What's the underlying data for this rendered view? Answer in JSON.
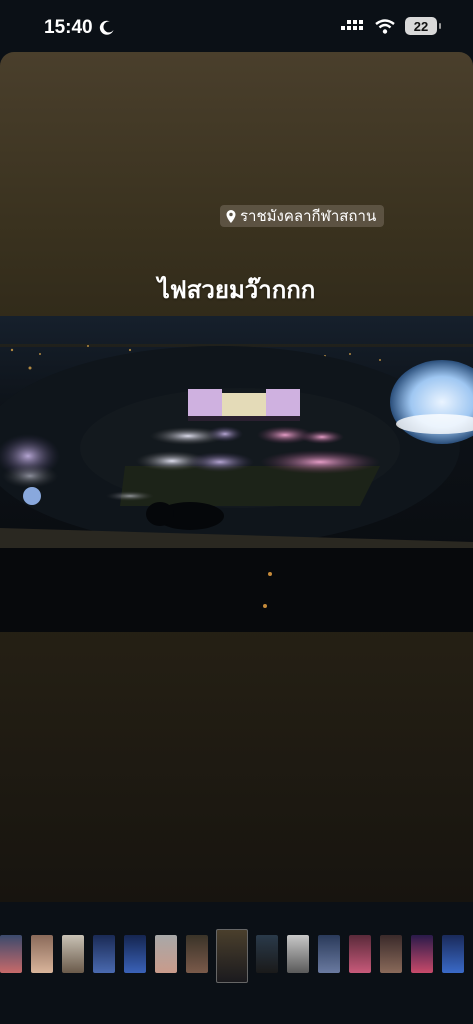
{
  "status_bar": {
    "time": "15:40",
    "battery": "22"
  },
  "story": {
    "location_label": "ราชมังคลากีฬาสถาน",
    "caption": "ไฟสวยมว๊ากกก"
  },
  "thumbnails": {
    "count": 15,
    "active_index": 7
  },
  "colors": {
    "background": "#0b1016",
    "story_top": "#4a3f2c",
    "story_bottom": "#17140f",
    "pink_light": "#e78fbf"
  }
}
